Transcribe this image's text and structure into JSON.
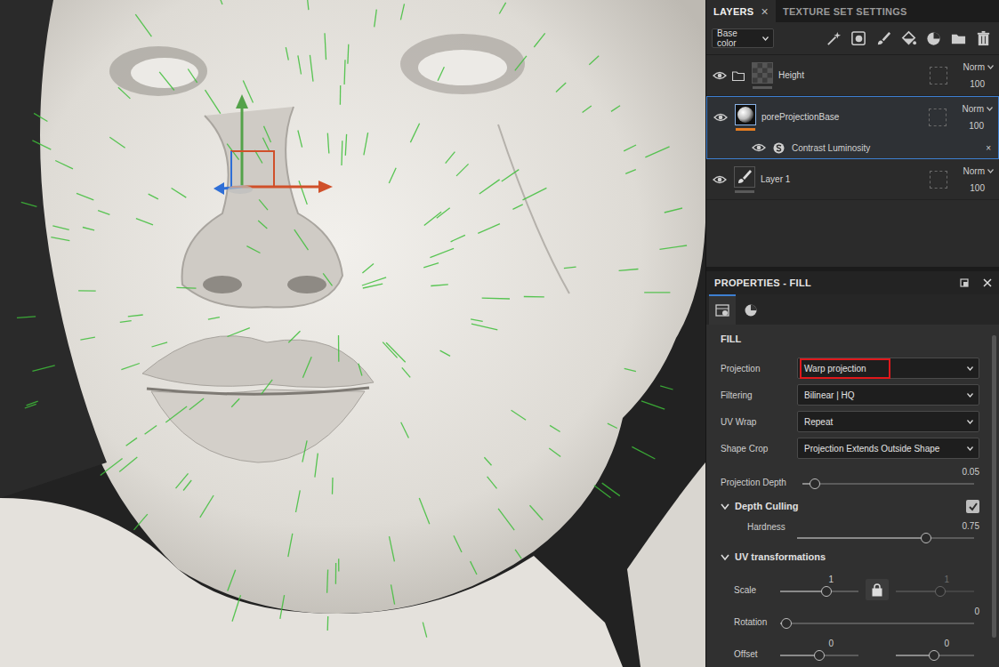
{
  "layers_panel": {
    "tabs": [
      {
        "label": "LAYERS",
        "selected": true,
        "close": "×"
      },
      {
        "label": "TEXTURE SET SETTINGS",
        "selected": false
      }
    ],
    "channel": "Base color",
    "layers": [
      {
        "name": "Height",
        "kind": "folder",
        "visible": true,
        "selected": false,
        "blend": "Norm",
        "opacity": "100",
        "effects": []
      },
      {
        "name": "poreProjectionBase",
        "kind": "fill",
        "visible": true,
        "selected": true,
        "blend": "Norm",
        "opacity": "100",
        "effects": [
          {
            "name": "Contrast Luminosity",
            "visible": true,
            "remove": "×"
          }
        ]
      },
      {
        "name": "Layer 1",
        "kind": "paint",
        "visible": true,
        "selected": false,
        "blend": "Norm",
        "opacity": "100",
        "effects": []
      }
    ]
  },
  "properties": {
    "title": "PROPERTIES - FILL",
    "tabs": [
      {
        "selected": true
      },
      {
        "selected": false
      }
    ],
    "section": "FILL",
    "rows": [
      {
        "kind": "dropdown",
        "label": "Projection",
        "value": "Warp projection",
        "highlighted": true
      },
      {
        "kind": "dropdown",
        "label": "Filtering",
        "value": "Bilinear | HQ",
        "highlighted": false
      },
      {
        "kind": "dropdown",
        "label": "UV Wrap",
        "value": "Repeat",
        "highlighted": false
      },
      {
        "kind": "dropdown",
        "label": "Shape Crop",
        "value": "Projection Extends Outside Shape",
        "highlighted": false
      },
      {
        "kind": "slider",
        "label": "Projection Depth",
        "reading": "0.05",
        "level": 0.07
      },
      {
        "kind": "group",
        "label": "Depth Culling",
        "expanded": true,
        "checked": true
      },
      {
        "kind": "stacked",
        "label": "Hardness",
        "reading": "0.75",
        "level": 0.73
      },
      {
        "kind": "group",
        "label": "UV transformations",
        "expanded": true
      },
      {
        "kind": "pair",
        "label": "Scale",
        "locked": true,
        "values": [
          {
            "reading": "1",
            "level": 0.59,
            "disabled": false
          },
          {
            "reading": "1",
            "level": 0.57,
            "disabled": true
          }
        ]
      },
      {
        "kind": "slider",
        "label": "Rotation",
        "reading": "0",
        "level": 0.03
      },
      {
        "kind": "pair",
        "label": "Offset",
        "values": [
          {
            "reading": "0",
            "level": 0.5,
            "disabled": false
          },
          {
            "reading": "0",
            "level": 0.49,
            "disabled": false
          }
        ]
      }
    ]
  }
}
